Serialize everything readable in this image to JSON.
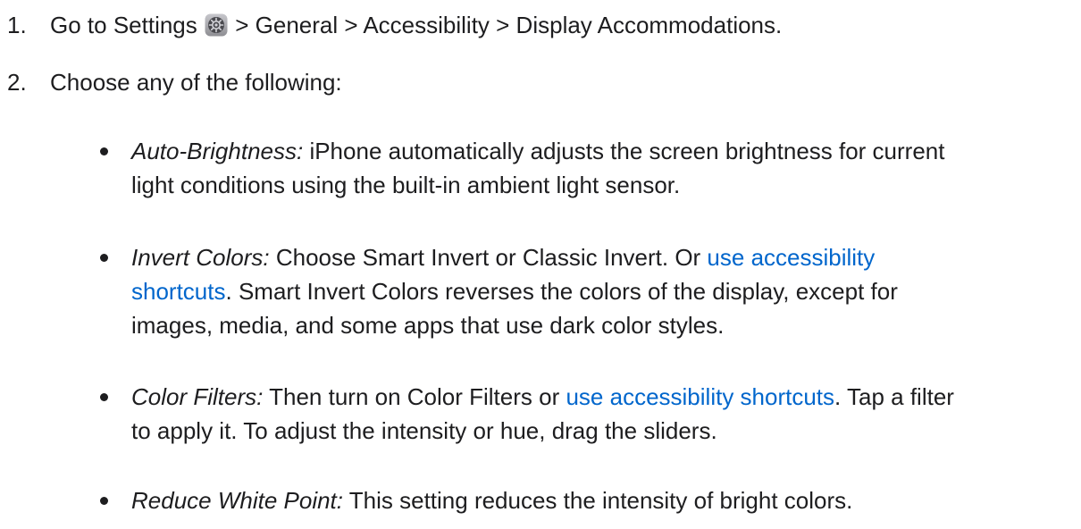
{
  "steps": [
    {
      "number": "1.",
      "prefix": "Go to Settings",
      "path_rest": "> General > Accessibility > Display Accommodations."
    },
    {
      "number": "2.",
      "text": "Choose any of the following:"
    }
  ],
  "icons": {
    "settings": "gear-icon"
  },
  "colors": {
    "text": "#1d1d1f",
    "link": "#0066cc"
  },
  "options": [
    {
      "term": "Auto-Brightness:",
      "line1": " iPhone automatically adjusts the screen brightness for current",
      "line2": "light conditions using the built-in ambient light sensor."
    },
    {
      "term": "Invert Colors:",
      "text_before": " Choose Smart Invert or Classic Invert. Or ",
      "link1": "use accessibility",
      "link2": "shortcuts",
      "text_after": ". Smart Invert Colors reverses the colors of the display, except for",
      "line3": "images, media, and some apps that use dark color styles."
    },
    {
      "term": "Color Filters:",
      "text_before": " Then turn on Color Filters or ",
      "link": "use accessibility shortcuts",
      "text_after": ". Tap a filter",
      "line2": "to apply it. To adjust the intensity or hue, drag the sliders."
    },
    {
      "term": "Reduce White Point:",
      "text": " This setting reduces the intensity of bright colors."
    }
  ]
}
